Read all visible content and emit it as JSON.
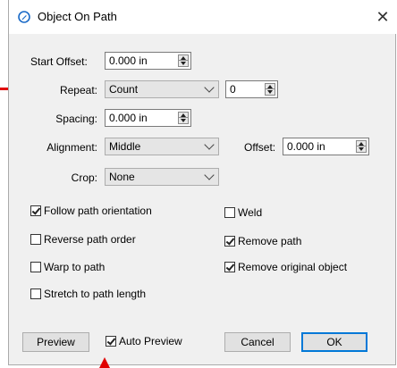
{
  "window": {
    "title": "Object On Path",
    "close_icon": "close-icon",
    "app_icon": "pen-nib-icon"
  },
  "fields": {
    "start_offset": {
      "label": "Start Offset:",
      "value": "0.000 in"
    },
    "repeat": {
      "label": "Repeat:",
      "mode": "Count",
      "count": "0"
    },
    "spacing": {
      "label": "Spacing:",
      "value": "0.000 in"
    },
    "alignment": {
      "label": "Alignment:",
      "value": "Middle"
    },
    "offset": {
      "label": "Offset:",
      "value": "0.000 in"
    },
    "crop": {
      "label": "Crop:",
      "value": "None"
    }
  },
  "options": {
    "follow_path_orientation": {
      "label": "Follow path orientation",
      "checked": true
    },
    "reverse_path_order": {
      "label": "Reverse path order",
      "checked": false
    },
    "warp_to_path": {
      "label": "Warp to path",
      "checked": false
    },
    "stretch_to_path_length": {
      "label": "Stretch to path length",
      "checked": false
    },
    "weld": {
      "label": "Weld",
      "checked": false
    },
    "remove_path": {
      "label": "Remove path",
      "checked": true
    },
    "remove_original_object": {
      "label": "Remove original object",
      "checked": true
    }
  },
  "footer": {
    "preview_label": "Preview",
    "auto_preview": {
      "label": "Auto Preview",
      "checked": true
    },
    "cancel_label": "Cancel",
    "ok_label": "OK"
  },
  "annotations": {
    "color": "#e00000"
  }
}
